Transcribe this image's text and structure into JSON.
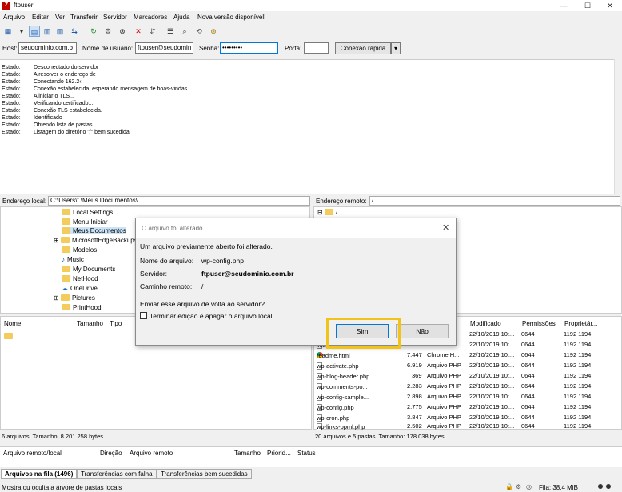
{
  "window": {
    "title": "ftpuser",
    "minimize": "—",
    "maximize": "☐",
    "close": "✕"
  },
  "menu": [
    "Arquivo",
    "Editar",
    "Ver",
    "Transferir",
    "Servidor",
    "Marcadores",
    "Ajuda",
    "Nova versão disponível!"
  ],
  "quickconnect": {
    "host_label": "Host:",
    "host_value": "seudominio.com.b",
    "user_label": "Nome de usuário:",
    "user_value": "ftpuser@seudomin",
    "pass_label": "Senha:",
    "pass_value": "•••••••••",
    "port_label": "Porta:",
    "port_value": "",
    "connect_button": "Conexão rápida",
    "dropdown": "▾"
  },
  "log": [
    {
      "k": "Estado:",
      "v": "Desconectado do servidor"
    },
    {
      "k": "Estado:",
      "v": "A resolver o endereço de"
    },
    {
      "k": "Estado:",
      "v": "Conectando 162.2‹"
    },
    {
      "k": "Estado:",
      "v": "Conexão estabelecida, esperando mensagem de boas-vindas..."
    },
    {
      "k": "Estado:",
      "v": "A iniciar o TLS..."
    },
    {
      "k": "Estado:",
      "v": "Verificando certificado..."
    },
    {
      "k": "Estado:",
      "v": "Conexão TLS estabelecida."
    },
    {
      "k": "Estado:",
      "v": "Identificado"
    },
    {
      "k": "Estado:",
      "v": "Obtendo lista de pastas..."
    },
    {
      "k": "Estado:",
      "v": "Listagem do diretório \"/\" bem sucedida"
    }
  ],
  "local": {
    "path_label": "Endereço local:",
    "path_value": "C:\\Users\\t            \\Meus Documentos\\",
    "tree": [
      "Local Settings",
      "Menu Iniciar",
      "Meus Documentos",
      "MicrosoftEdgeBackups",
      "Modelos",
      "Music",
      "My Documents",
      "NetHood",
      "OneDrive",
      "Pictures",
      "PrintHood"
    ],
    "cols": {
      "name": "Nome",
      "size": "Tamanho",
      "type": "Tipo"
    },
    "files": [
      ".."
    ],
    "status": "6 arquivos. Tamanho: 8.201.258 bytes"
  },
  "remote": {
    "path_label": "Endereço remoto:",
    "path_value": "/",
    "tree_root": "/",
    "cols": {
      "modified": "Modificado",
      "perms": "Permissões",
      "owner": "Proprietár..."
    },
    "files": [
      {
        "name": "",
        "size": "",
        "type": "",
        "modified": "22/10/2019 10:...",
        "perms": "0644",
        "owner": "1192 1194"
      },
      {
        "name": "license.txt",
        "size": "19.935",
        "type": "Documen...",
        "modified": "22/10/2019 10:...",
        "perms": "0644",
        "owner": "1192 1194"
      },
      {
        "name": "readme.html",
        "size": "7.447",
        "type": "Chrome H...",
        "modified": "22/10/2019 10:...",
        "perms": "0644",
        "owner": "1192 1194"
      },
      {
        "name": "wp-activate.php",
        "size": "6.919",
        "type": "Arquivo PHP",
        "modified": "22/10/2019 10:...",
        "perms": "0644",
        "owner": "1192 1194"
      },
      {
        "name": "wp-blog-header.php",
        "size": "369",
        "type": "Arquivo PHP",
        "modified": "22/10/2019 10:...",
        "perms": "0644",
        "owner": "1192 1194"
      },
      {
        "name": "wp-comments-po...",
        "size": "2.283",
        "type": "Arquivo PHP",
        "modified": "22/10/2019 10:...",
        "perms": "0644",
        "owner": "1192 1194"
      },
      {
        "name": "wp-config-sample...",
        "size": "2.898",
        "type": "Arquivo PHP",
        "modified": "22/10/2019 10:...",
        "perms": "0644",
        "owner": "1192 1194"
      },
      {
        "name": "wp-config.php",
        "size": "2.775",
        "type": "Arquivo PHP",
        "modified": "22/10/2019 10:...",
        "perms": "0644",
        "owner": "1192 1194"
      },
      {
        "name": "wp-cron.php",
        "size": "3.847",
        "type": "Arquivo PHP",
        "modified": "22/10/2019 10:...",
        "perms": "0644",
        "owner": "1192 1194"
      },
      {
        "name": "wp-links-opml.php",
        "size": "2.502",
        "type": "Arquivo PHP",
        "modified": "22/10/2019 10:...",
        "perms": "0644",
        "owner": "1192 1194"
      }
    ],
    "status": "20 arquivos e 5 pastas. Tamanho: 178.038 bytes"
  },
  "queue": {
    "cols": [
      "Arquivo remoto/local",
      "Direção",
      "Arquivo remoto",
      "Tamanho",
      "Priorid...",
      "Status"
    ]
  },
  "tabs": [
    "Arquivos na fila (1496)",
    "Transferências com falha",
    "Transferências bem sucedidas"
  ],
  "statusbar": {
    "hint": "Mostra ou oculta a árvore de pastas locais",
    "queue": "Fila: 38,4 MiB"
  },
  "dialog": {
    "title": "O arquivo foi alterado",
    "message": "Um arquivo previamente aberto foi alterado.",
    "filename_label": "Nome do arquivo:",
    "filename": "wp-config.php",
    "server_label": "Servidor:",
    "server": "ftpuser@seudominio.com.br",
    "remote_label": "Caminho remoto:",
    "remote": "/",
    "question": "Enviar esse arquivo de volta ao servidor?",
    "checkbox": "Terminar edição e apagar o arquivo local",
    "yes": "Sim",
    "no": "Não",
    "close": "✕"
  },
  "colors": {
    "highlight": "#f2c31a",
    "brand": "#bf0000"
  }
}
